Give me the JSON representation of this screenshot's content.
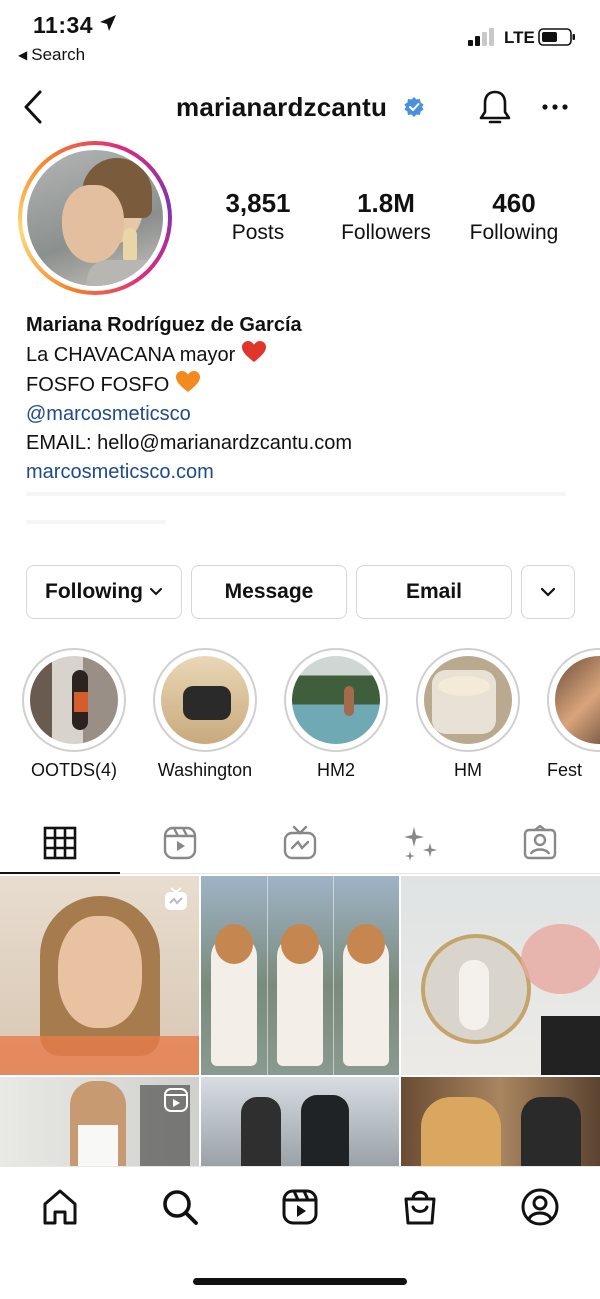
{
  "status_bar": {
    "time": "11:34",
    "back_label": "Search",
    "network": "LTE"
  },
  "header": {
    "username": "marianardzcantu",
    "icons": [
      "chevron-left-icon",
      "verified-badge-icon",
      "bell-icon",
      "more-icon"
    ]
  },
  "stats": {
    "posts": {
      "value": "3,851",
      "label": "Posts"
    },
    "followers": {
      "value": "1.8M",
      "label": "Followers"
    },
    "following": {
      "value": "460",
      "label": "Following"
    }
  },
  "bio": {
    "name": "Mariana Rodríguez de García",
    "line1": "La CHAVACANA mayor",
    "line2": "FOSFO FOSFO",
    "mention": "@marcosmeticsco",
    "email_line": "EMAIL: hello@marianardzcantu.com",
    "website": "marcosmeticsco.com",
    "colors": {
      "link": "#1f4a8a",
      "heart_red": "#e0352b",
      "heart_orange": "#f28a1e"
    }
  },
  "actions": {
    "following": "Following",
    "message": "Message",
    "email": "Email"
  },
  "highlights": [
    {
      "label": "OOTDS(4)"
    },
    {
      "label": "Washington"
    },
    {
      "label": "HM2"
    },
    {
      "label": "HM"
    },
    {
      "label": "Fest"
    }
  ],
  "tabs": [
    "grid-icon",
    "reels-icon",
    "igtv-icon",
    "effects-icon",
    "tagged-icon"
  ],
  "bottom_nav": [
    "home-icon",
    "search-icon",
    "reels-icon",
    "shop-icon",
    "profile-icon"
  ]
}
